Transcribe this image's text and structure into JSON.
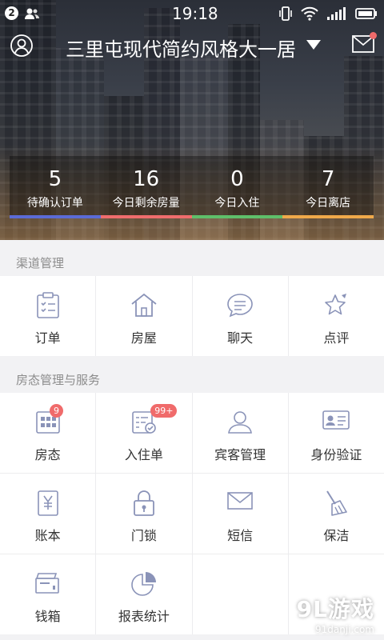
{
  "status_bar": {
    "notification_count": "2",
    "time": "19:18"
  },
  "header": {
    "title": "三里屯现代简约风格大一居"
  },
  "stats": [
    {
      "value": "5",
      "label": "待确认订单",
      "bar_color": "#5b6bd6"
    },
    {
      "value": "16",
      "label": "今日剩余房量",
      "bar_color": "#ef6d6d"
    },
    {
      "value": "0",
      "label": "今日入住",
      "bar_color": "#5fbf6a"
    },
    {
      "value": "7",
      "label": "今日离店",
      "bar_color": "#f0a94a"
    }
  ],
  "sections": {
    "channel": {
      "title": "渠道管理",
      "items": [
        {
          "label": "订单"
        },
        {
          "label": "房屋"
        },
        {
          "label": "聊天"
        },
        {
          "label": "点评"
        }
      ]
    },
    "room": {
      "title": "房态管理与服务",
      "items": [
        {
          "label": "房态",
          "badge": "9"
        },
        {
          "label": "入住单",
          "badge": "99+"
        },
        {
          "label": "宾客管理"
        },
        {
          "label": "身份验证"
        },
        {
          "label": "账本"
        },
        {
          "label": "门锁"
        },
        {
          "label": "短信"
        },
        {
          "label": "保洁"
        },
        {
          "label": "钱箱"
        },
        {
          "label": "报表统计"
        }
      ]
    }
  },
  "watermark": {
    "big": "9L游戏",
    "small": "91danji.com"
  },
  "colors": {
    "icon": "#8a93b8",
    "badge": "#f06b6b"
  }
}
